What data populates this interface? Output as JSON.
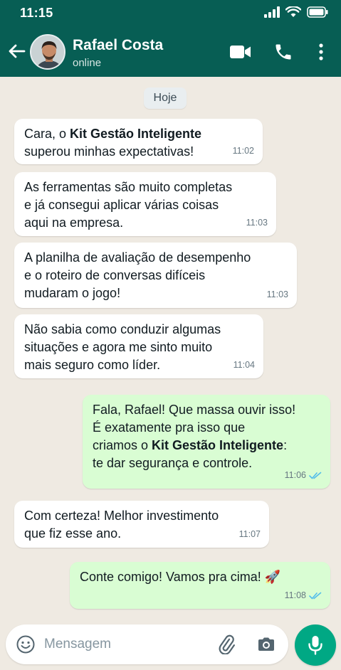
{
  "status_bar": {
    "time": "11:15"
  },
  "contact": {
    "name": "Rafael Costa",
    "status": "online"
  },
  "icons": {
    "back": "arrow-left-icon",
    "video": "video-call-icon",
    "call": "phone-icon",
    "menu": "more-vertical-icon",
    "emoji": "emoji-icon",
    "attach": "paperclip-icon",
    "camera": "camera-icon",
    "mic": "microphone-icon",
    "read": "double-check-icon"
  },
  "colors": {
    "header": "#075e54",
    "chat_bg": "#efeae2",
    "incoming": "#ffffff",
    "outgoing": "#d9fdd3",
    "accent": "#00a884",
    "read_tick": "#53bdeb"
  },
  "chat": {
    "day_label": "Hoje",
    "messages": [
      {
        "dir": "in",
        "parts": [
          {
            "t": "Cara, o "
          },
          {
            "t": "Kit Gestão Inteligente",
            "b": true
          },
          {
            "t": "\nsuperou minhas expectativas!"
          }
        ],
        "time": "11:02"
      },
      {
        "dir": "in",
        "parts": [
          {
            "t": "As ferramentas são muito completas\ne já consegui aplicar várias coisas\naqui na empresa."
          }
        ],
        "time": "11:03"
      },
      {
        "dir": "in",
        "parts": [
          {
            "t": "A planilha de avaliação de desempenho\ne o roteiro de conversas difíceis\nmudaram o jogo!"
          }
        ],
        "time": "11:03"
      },
      {
        "dir": "in",
        "parts": [
          {
            "t": "Não sabia como conduzir algumas\nsituações e agora me sinto muito\nmais seguro como líder."
          }
        ],
        "time": "11:04"
      },
      {
        "dir": "out",
        "parts": [
          {
            "t": "Fala, Rafael! Que massa ouvir isso!\nÉ exatamente pra isso que\ncriamos o "
          },
          {
            "t": "Kit Gestão Inteligente",
            "b": true
          },
          {
            "t": ":\nte dar segurança e controle."
          }
        ],
        "time": "11:06",
        "read": true
      },
      {
        "dir": "in",
        "parts": [
          {
            "t": "Com certeza! Melhor investimento\nque fiz esse ano."
          }
        ],
        "time": "11:07"
      },
      {
        "dir": "out",
        "parts": [
          {
            "t": "Conte comigo! Vamos pra cima! 🚀"
          }
        ],
        "time": "11:08",
        "read": true
      }
    ]
  },
  "composer": {
    "placeholder": "Mensagem",
    "value": ""
  }
}
